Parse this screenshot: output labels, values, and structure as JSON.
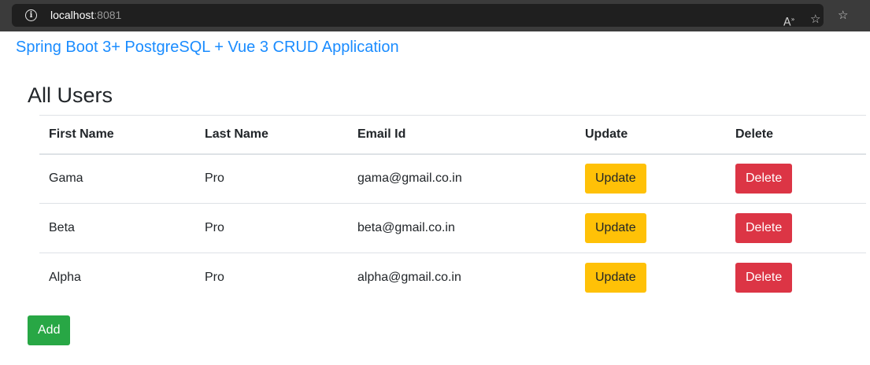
{
  "browser": {
    "url_host": "localhost",
    "url_port": ":8081",
    "icons": {
      "info": "info-icon",
      "read_aloud": "read-aloud-icon",
      "add_favorite": "add-favorite-icon",
      "favorites": "favorites-icon"
    }
  },
  "header": {
    "brand": "Spring Boot 3+ PostgreSQL + Vue 3 CRUD Application",
    "brand_color": "#1a8cff"
  },
  "main": {
    "title": "All Users",
    "table": {
      "columns": [
        "First Name",
        "Last Name",
        "Email Id",
        "Update",
        "Delete"
      ],
      "rows": [
        {
          "first_name": "Gama",
          "last_name": "Pro",
          "email": "gama@gmail.co.in",
          "update_label": "Update",
          "delete_label": "Delete"
        },
        {
          "first_name": "Beta",
          "last_name": "Pro",
          "email": "beta@gmail.co.in",
          "update_label": "Update",
          "delete_label": "Delete"
        },
        {
          "first_name": "Alpha",
          "last_name": "Pro",
          "email": "alpha@gmail.co.in",
          "update_label": "Update",
          "delete_label": "Delete"
        }
      ]
    },
    "add_label": "Add"
  },
  "colors": {
    "update": "#ffc107",
    "delete": "#dc3545",
    "add": "#28a745"
  }
}
